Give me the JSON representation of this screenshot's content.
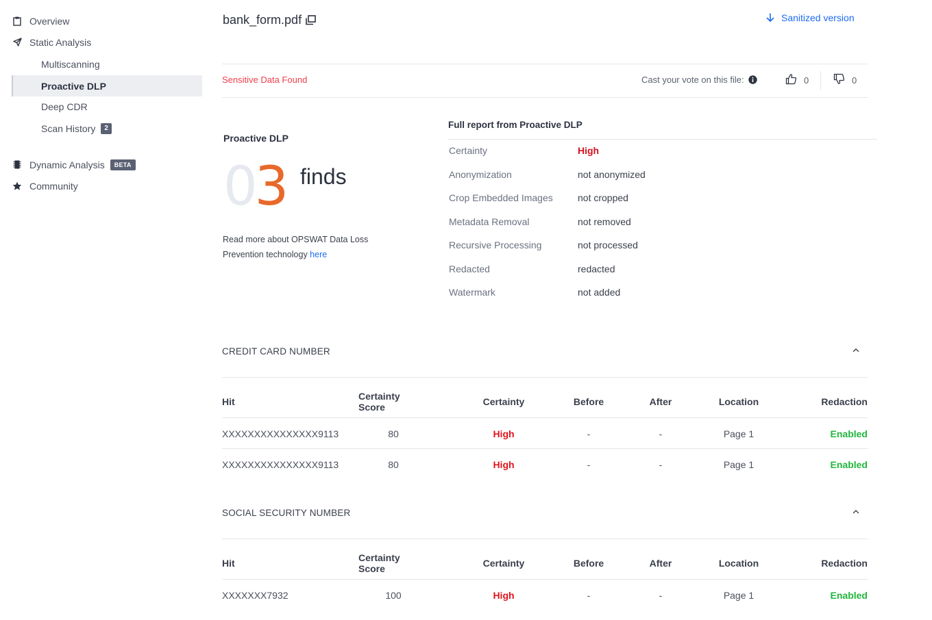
{
  "sidebar": {
    "overview": "Overview",
    "static_analysis": "Static Analysis",
    "multiscanning": "Multiscanning",
    "proactive_dlp": "Proactive DLP",
    "deep_cdr": "Deep CDR",
    "scan_history": "Scan History",
    "scan_history_count": "2",
    "dynamic_analysis": "Dynamic Analysis",
    "dynamic_badge": "BETA",
    "community": "Community",
    "icons": [
      "clipboard-icon",
      "paper-plane-icon",
      "chip-icon",
      "star-icon"
    ]
  },
  "header": {
    "file_name": "bank_form.pdf",
    "sanitized_label": "Sanitized version"
  },
  "vote": {
    "status": "Sensitive Data Found",
    "cast_label": "Cast your vote on this file:",
    "up_count": "0",
    "down_count": "0"
  },
  "summary": {
    "title": "Proactive DLP",
    "count_lead": "0",
    "count_digit": "3",
    "count_suffix": "finds",
    "read_more_text": "Read more about OPSWAT Data Loss Prevention technology ",
    "read_more_link": "here"
  },
  "report": {
    "title": "Full report from Proactive DLP",
    "rows": [
      {
        "key": "Certainty",
        "value": "High"
      },
      {
        "key": "Anonymization",
        "value": "not anonymized"
      },
      {
        "key": "Crop Embedded Images",
        "value": "not cropped"
      },
      {
        "key": "Metadata Removal",
        "value": "not removed"
      },
      {
        "key": "Recursive Processing",
        "value": "not processed"
      },
      {
        "key": "Redacted",
        "value": "redacted"
      },
      {
        "key": "Watermark",
        "value": "not added"
      }
    ]
  },
  "columns": [
    "Hit",
    "Certainty Score",
    "Certainty",
    "Before",
    "After",
    "Location",
    "Redaction"
  ],
  "sections": [
    {
      "title": "CREDIT CARD NUMBER",
      "rows": [
        {
          "hit": "XXXXXXXXXXXXXXX9113",
          "score": "80",
          "certainty": "High",
          "before": "-",
          "after": "-",
          "location": "Page 1",
          "redaction": "Enabled"
        },
        {
          "hit": "XXXXXXXXXXXXXXX9113",
          "score": "80",
          "certainty": "High",
          "before": "-",
          "after": "-",
          "location": "Page 1",
          "redaction": "Enabled"
        }
      ]
    },
    {
      "title": "SOCIAL SECURITY NUMBER",
      "rows": [
        {
          "hit": "XXXXXXX7932",
          "score": "100",
          "certainty": "High",
          "before": "-",
          "after": "-",
          "location": "Page 1",
          "redaction": "Enabled"
        }
      ]
    }
  ],
  "colors": {
    "accent_blue": "#1d6bf3",
    "alert_red": "#ef3e4a",
    "high_red": "#e0141f",
    "enabled_green": "#21b63c",
    "count_orange": "#e8692a"
  }
}
